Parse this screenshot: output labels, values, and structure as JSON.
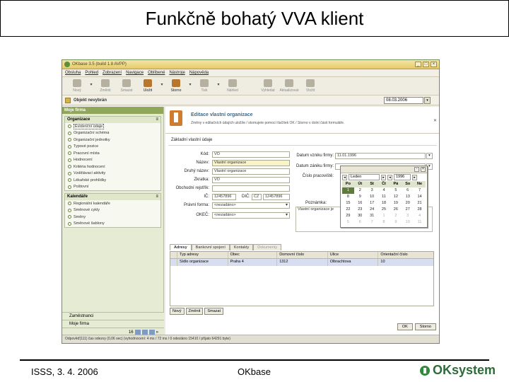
{
  "slide": {
    "title": "Funkčně bohatý VVA klient",
    "footer_left": "ISSS, 3. 4. 2006",
    "footer_center": "OKbase",
    "footer_logo": "OKsystem"
  },
  "app": {
    "window_title": "OKbase 3.5 (build 1.8 AVPP)",
    "menu": [
      "Obsluha",
      "Pohled",
      "Zobrazení",
      "Navigace",
      "Oblíbené",
      "Nástroje",
      "Nápověda"
    ],
    "toolbar": [
      {
        "label": "Nový",
        "enabled": false
      },
      {
        "label": "Změnit",
        "enabled": false
      },
      {
        "label": "Smazat",
        "enabled": false
      },
      {
        "label": "Uložit",
        "enabled": true
      },
      {
        "label": "Storno",
        "enabled": true
      },
      {
        "label": "Tisk",
        "enabled": false
      },
      {
        "label": "Náhled",
        "enabled": false
      },
      {
        "label": "Vyhledat",
        "enabled": false
      },
      {
        "label": "Aktualizovat",
        "enabled": false
      },
      {
        "label": "Vložit",
        "enabled": false
      }
    ],
    "object_bar": {
      "text": "Objekt nevybrán",
      "date": "08.03.2006"
    },
    "sidebar": {
      "header": "Moje firma",
      "organizace": {
        "title": "Organizace",
        "items": [
          "Evidenční údaje",
          "Organizační schéma",
          "Organizační jednotky",
          "Typové pozice",
          "Pracovní místa",
          "Hodnocení",
          "Kritéria hodnocení",
          "Vzdělávací aktivity",
          "Lékařské prohlídky",
          "Poštovní"
        ]
      },
      "kalendare": {
        "title": "Kalendáře",
        "items": [
          "Regionální kalendáře",
          "Směnové cykly",
          "Směny",
          "Směnové šablony"
        ]
      },
      "bottom": {
        "zamestnanci": "Zaměstnanci",
        "moje_firma": "Moje firma",
        "count": "16"
      }
    },
    "main": {
      "title": "Editace vlastní organizace",
      "desc": "Změny v editačních údajích uložíte / stornujete pomocí tlačítek OK / Storno v dolní části formuláře.",
      "section": "Základní vlastní údaje",
      "fields": {
        "kod_label": "Kód:",
        "kod": "VO",
        "nazev_label": "Název:",
        "nazev": "Vlastní organizace",
        "druhy_nazev_label": "Druhý název:",
        "druhy_nazev": "Vlastní organizace",
        "zkratka_label": "Zkratka:",
        "zkratka": "VO",
        "rejstrik_label": "Obchodní rejstřík:",
        "rejstrik": "",
        "ic_label": "IČ:",
        "ic": "12457896",
        "dic_label": "DIČ:",
        "dic_prefix": "CZ",
        "dic": "12457896",
        "pravni_forma_label": "Právní forma:",
        "pravni_forma": "<nezadáno>",
        "okec_label": "OKEČ:",
        "okec": "<nezadáno>",
        "datum_zanik_label": "Datum vzniku firmy:",
        "datum_vzniku": "11.01.1996",
        "datum_zaniku_label": "Datum zániku firmy:",
        "datum_zaniku": "",
        "cislo_label": "Číslo pracoviště:",
        "poznamka_label": "Poznámka:",
        "poznamka": "Vlastní organizace je"
      },
      "tabs": [
        {
          "label": "Adresy",
          "state": "selected"
        },
        {
          "label": "Bankovní spojení",
          "state": "normal"
        },
        {
          "label": "Kontakty",
          "state": "normal"
        },
        {
          "label": "Dokumenty",
          "state": "disabled"
        }
      ],
      "grid": {
        "columns": [
          "Typ adresy",
          "Obec",
          "Domovní číslo",
          "Ulice",
          "Orientační číslo"
        ],
        "rows": [
          [
            "Sídlo organizace",
            "Praha 4",
            "1312",
            "Olbrachtova",
            "10"
          ]
        ]
      },
      "grid_buttons": [
        "Nový",
        "Změnit",
        "Smazat"
      ],
      "ok_label": "OK",
      "storno_label": "Storno"
    },
    "calendar": {
      "month": "Leden",
      "year": "1996",
      "days_header": [
        "Po",
        "Út",
        "St",
        "Čt",
        "Pá",
        "So",
        "Ne"
      ],
      "weeks": [
        [
          "1",
          "2",
          "3",
          "4",
          "5",
          "6",
          "7"
        ],
        [
          "8",
          "9",
          "10",
          "11",
          "12",
          "13",
          "14"
        ],
        [
          "15",
          "16",
          "17",
          "18",
          "19",
          "20",
          "21"
        ],
        [
          "22",
          "23",
          "24",
          "25",
          "26",
          "27",
          "28"
        ],
        [
          "29",
          "30",
          "31",
          "1",
          "2",
          "3",
          "4"
        ],
        [
          "5",
          "6",
          "7",
          "8",
          "9",
          "10",
          "11"
        ]
      ],
      "today": "1"
    },
    "status_bar": "Odpověď(111) čas odezvy (0,06 sec) (vyhodnocení: 4 ms / 72 ms / 0 odesláno 15410 / přijato 64291 byte)"
  }
}
